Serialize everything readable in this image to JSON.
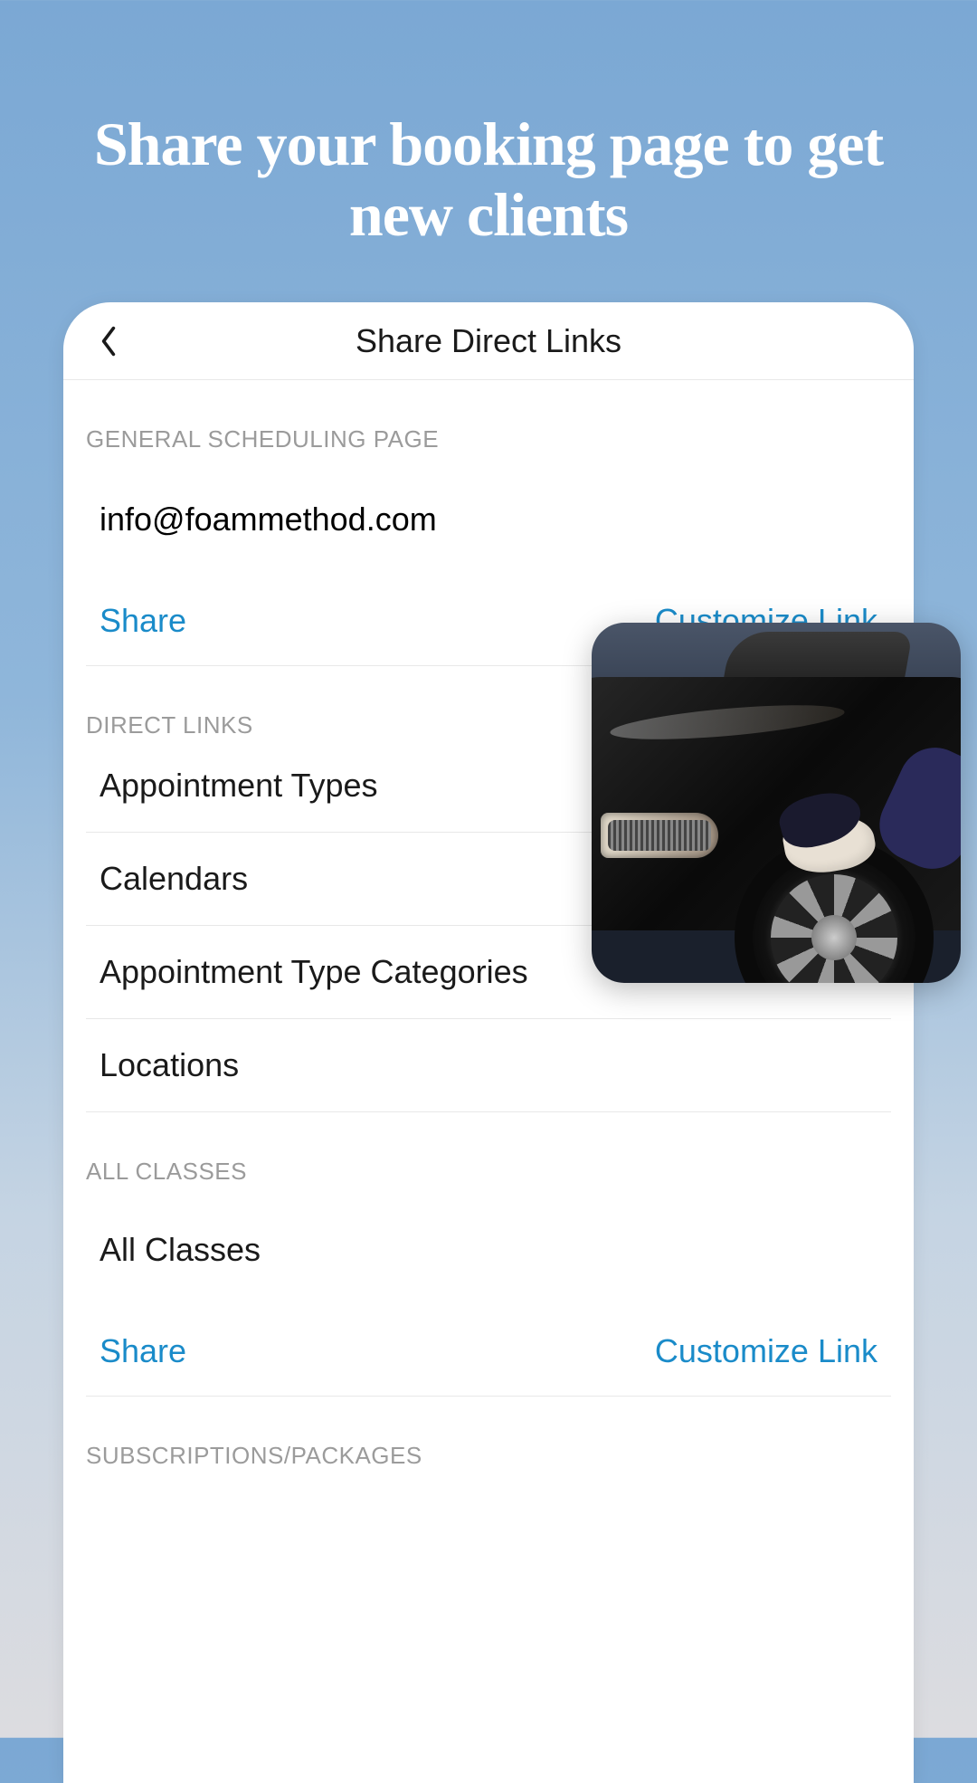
{
  "promo": {
    "heading": "Share your booking page to get new clients"
  },
  "header": {
    "title": "Share Direct Links"
  },
  "sections": {
    "general_scheduling": {
      "label": "GENERAL SCHEDULING PAGE",
      "email": "info@foammethod.com",
      "share": "Share",
      "customize": "Customize Link"
    },
    "direct_links": {
      "label": "DIRECT LINKS",
      "items": [
        "Appointment Types",
        "Calendars",
        "Appointment Type Categories",
        "Locations"
      ]
    },
    "all_classes": {
      "label": "ALL CLASSES",
      "title": "All Classes",
      "share": "Share",
      "customize": "Customize Link"
    },
    "subscriptions": {
      "label": "SUBSCRIPTIONS/PACKAGES"
    }
  }
}
